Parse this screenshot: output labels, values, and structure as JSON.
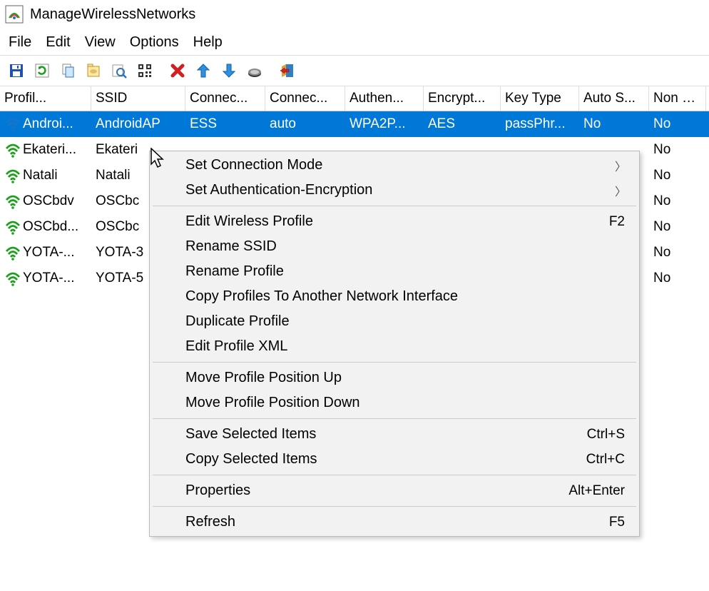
{
  "title": "ManageWirelessNetworks",
  "menubar": [
    "File",
    "Edit",
    "View",
    "Options",
    "Help"
  ],
  "columns": [
    "Profil...",
    "SSID",
    "Connec...",
    "Connec...",
    "Authen...",
    "Encrypt...",
    "Key Type",
    "Auto S...",
    "Non B..."
  ],
  "rows": [
    {
      "selected": true,
      "profile": "Androi...",
      "ssid": "AndroidAP",
      "c2": "ESS",
      "c3": "auto",
      "c4": "WPA2P...",
      "c5": "AES",
      "c6": "passPhr...",
      "c7": "No",
      "c8": "No"
    },
    {
      "selected": false,
      "profile": "Ekateri...",
      "ssid": "Ekateri",
      "c2": "",
      "c3": "",
      "c4": "",
      "c5": "",
      "c6": "",
      "c7": "",
      "c8": "No"
    },
    {
      "selected": false,
      "profile": "Natali",
      "ssid": "Natali",
      "c2": "",
      "c3": "",
      "c4": "",
      "c5": "",
      "c6": "",
      "c7": "",
      "c8": "No"
    },
    {
      "selected": false,
      "profile": "OSCbdv",
      "ssid": "OSCbc",
      "c2": "",
      "c3": "",
      "c4": "",
      "c5": "",
      "c6": "",
      "c7": "",
      "c8": "No"
    },
    {
      "selected": false,
      "profile": "OSCbd...",
      "ssid": "OSCbc",
      "c2": "",
      "c3": "",
      "c4": "",
      "c5": "",
      "c6": "",
      "c7": "",
      "c8": "No"
    },
    {
      "selected": false,
      "profile": "YOTA-...",
      "ssid": "YOTA-3",
      "c2": "",
      "c3": "",
      "c4": "",
      "c5": "",
      "c6": "",
      "c7": "",
      "c8": "No"
    },
    {
      "selected": false,
      "profile": "YOTA-...",
      "ssid": "YOTA-5",
      "c2": "",
      "c3": "",
      "c4": "",
      "c5": "",
      "c6": "",
      "c7": "",
      "c8": "No"
    }
  ],
  "context_menu": [
    {
      "type": "item",
      "label": "Set Connection Mode",
      "submenu": true
    },
    {
      "type": "item",
      "label": "Set Authentication-Encryption",
      "submenu": true
    },
    {
      "type": "sep"
    },
    {
      "type": "item",
      "label": "Edit Wireless Profile",
      "shortcut": "F2"
    },
    {
      "type": "item",
      "label": "Rename SSID"
    },
    {
      "type": "item",
      "label": "Rename Profile"
    },
    {
      "type": "item",
      "label": "Copy Profiles To Another Network Interface"
    },
    {
      "type": "item",
      "label": "Duplicate Profile"
    },
    {
      "type": "item",
      "label": "Edit Profile XML"
    },
    {
      "type": "sep"
    },
    {
      "type": "item",
      "label": "Move Profile Position Up"
    },
    {
      "type": "item",
      "label": "Move Profile Position Down"
    },
    {
      "type": "sep"
    },
    {
      "type": "item",
      "label": "Save Selected Items",
      "shortcut": "Ctrl+S"
    },
    {
      "type": "item",
      "label": "Copy Selected Items",
      "shortcut": "Ctrl+C"
    },
    {
      "type": "sep"
    },
    {
      "type": "item",
      "label": "Properties",
      "shortcut": "Alt+Enter"
    },
    {
      "type": "sep"
    },
    {
      "type": "item",
      "label": "Refresh",
      "shortcut": "F5"
    }
  ]
}
